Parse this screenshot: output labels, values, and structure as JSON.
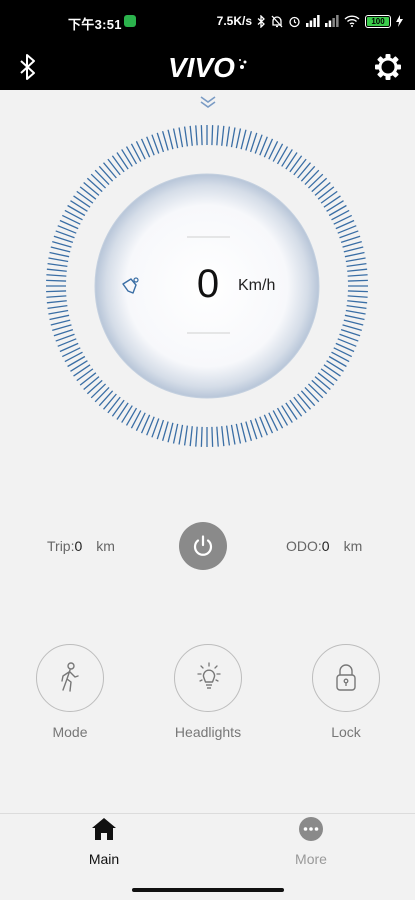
{
  "status_bar": {
    "time": "下午3:51",
    "net_speed": "7.5K/s",
    "battery": "100"
  },
  "header": {
    "logo": "VIVO",
    "bluetooth_icon": "bluetooth-icon",
    "settings_icon": "gear-icon"
  },
  "speedometer": {
    "speed": "0",
    "unit": "Km/h"
  },
  "stats": {
    "trip_label": "Trip:",
    "trip_value": "0",
    "trip_unit": "km",
    "odo_label": "ODO:",
    "odo_value": "0",
    "odo_unit": "km"
  },
  "controls": [
    {
      "label": "Mode",
      "icon": "walking-person-icon"
    },
    {
      "label": "Headlights",
      "icon": "light-bulb-icon"
    },
    {
      "label": "Lock",
      "icon": "padlock-icon"
    }
  ],
  "tabs": [
    {
      "label": "Main",
      "icon": "home-icon",
      "active": true
    },
    {
      "label": "More",
      "icon": "more-dots-icon",
      "active": false
    }
  ],
  "colors": {
    "gauge_tick": "#3a6ea5",
    "header_bg": "#000000",
    "power_button": "#8a8a8a"
  }
}
